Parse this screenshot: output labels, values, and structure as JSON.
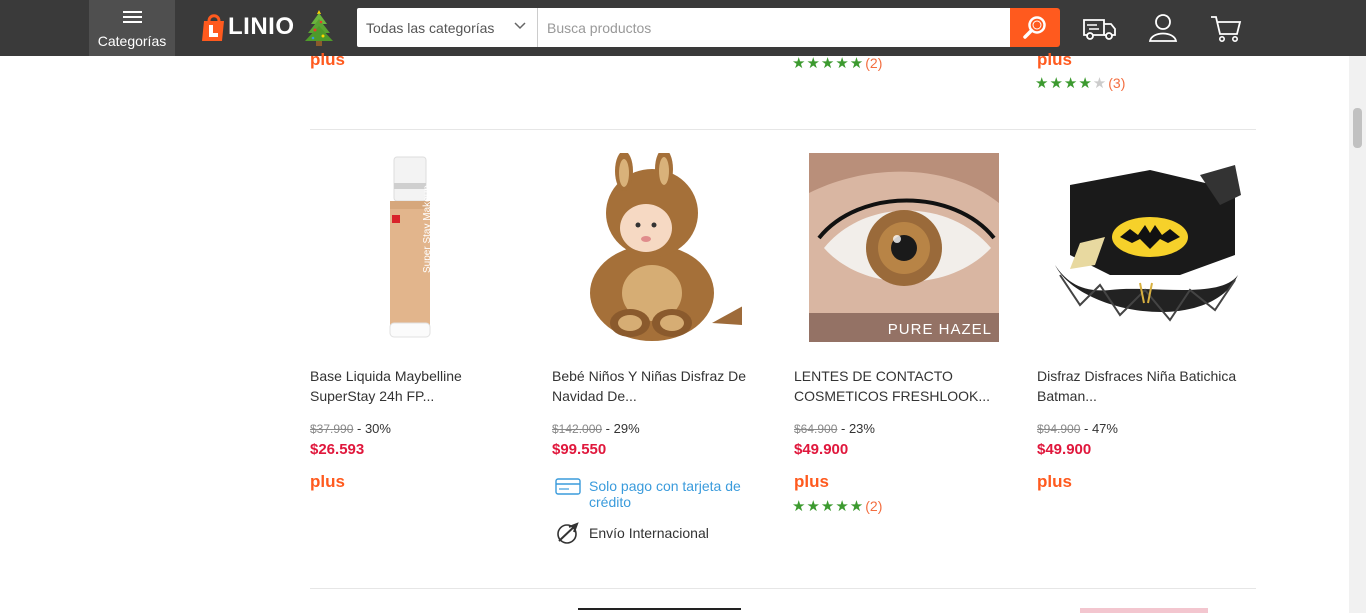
{
  "header": {
    "categories_label": "Categorías",
    "logo_text": "LINIO",
    "search_category": "Todas las categorías",
    "search_placeholder": "Busca productos"
  },
  "top_row": {
    "col1_plus": "plus",
    "col3_rating_count": "(2)",
    "col4_plus": "plus",
    "col4_rating_count": "(3)",
    "col3_rating": 5,
    "col4_rating": 4
  },
  "products": [
    {
      "name_line1": "Base Liquida Maybelline",
      "name_line2": "SuperStay 24h FP...",
      "old_price": "$37.990",
      "discount": " - 30%",
      "price": "$26.593",
      "plus": "plus",
      "image_text": "Super Stay Makeup"
    },
    {
      "name_line1": "Bebé Niños Y Niñas Disfraz De",
      "name_line2": "Navidad De...",
      "old_price": "$142.000",
      "discount": " - 29%",
      "price": "$99.550",
      "credit_note": "Solo pago con tarjeta de crédito",
      "shipping_note": "Envío Internacional"
    },
    {
      "name_line1": "LENTES DE CONTACTO",
      "name_line2": "COSMETICOS FRESHLOOK...",
      "old_price": "$64.900",
      "discount": " - 23%",
      "price": "$49.900",
      "plus": "plus",
      "rating": 5,
      "rating_count": "(2)",
      "image_text": "PURE HAZEL"
    },
    {
      "name_line1": "Disfraz Disfraces Niña Batichica",
      "name_line2": "Batman...",
      "old_price": "$94.900",
      "discount": " - 47%",
      "price": "$49.900",
      "plus": "plus"
    }
  ],
  "colors": {
    "header_bg": "#3a3a3a",
    "accent_orange": "#ff5a1e",
    "price_red": "#e0173c",
    "star_green": "#3c9a2f",
    "link_blue": "#3a9bdc"
  }
}
